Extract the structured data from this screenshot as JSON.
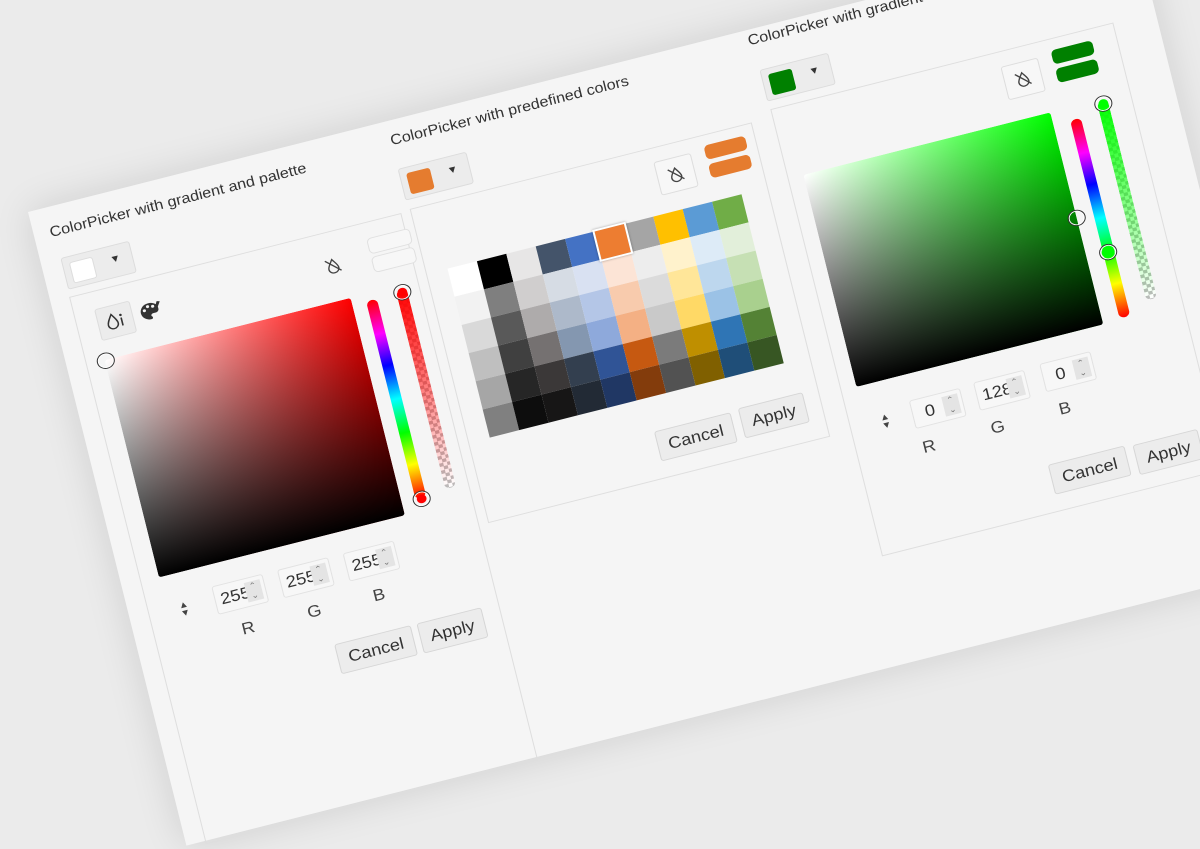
{
  "colors": {
    "orange": "#e57c2f",
    "green": "#008000",
    "white": "#ffffff"
  },
  "panels": {
    "gradient_palette": {
      "title": "ColorPicker with gradient and palette",
      "selected_color": "#ffffff",
      "inputs": [
        {
          "label": "R",
          "value": "255"
        },
        {
          "label": "G",
          "value": "255"
        },
        {
          "label": "B",
          "value": "255"
        }
      ],
      "cancel": "Cancel",
      "apply": "Apply"
    },
    "predefined": {
      "title": "ColorPicker with predefined colors",
      "selected_color": "#e57c2f",
      "cancel": "Cancel",
      "apply": "Apply",
      "palette": [
        [
          "#ffffff",
          "#000000",
          "#e7e6e6",
          "#44546a",
          "#4472c4",
          "#ed7d31",
          "#a5a5a5",
          "#ffc000",
          "#5b9bd5",
          "#70ad47"
        ],
        [
          "#f2f2f2",
          "#7f7f7f",
          "#d0cece",
          "#d6dce4",
          "#d9e1f2",
          "#fce4d6",
          "#ededed",
          "#fff2cc",
          "#ddebf7",
          "#e2efda"
        ],
        [
          "#d9d9d9",
          "#595959",
          "#aeabab",
          "#adb9ca",
          "#b4c6e7",
          "#f8cbad",
          "#dbdbdb",
          "#ffe699",
          "#bdd7ee",
          "#c6e0b4"
        ],
        [
          "#bfbfbf",
          "#404040",
          "#757171",
          "#8497b0",
          "#8ea9db",
          "#f4b084",
          "#c9c9c9",
          "#ffd966",
          "#9bc2e6",
          "#a9d08e"
        ],
        [
          "#a6a6a6",
          "#262626",
          "#3b3838",
          "#333f4f",
          "#305496",
          "#c65911",
          "#7b7b7b",
          "#bf8f00",
          "#2f75b5",
          "#548235"
        ],
        [
          "#808080",
          "#0d0d0d",
          "#171616",
          "#222a35",
          "#203764",
          "#833c0c",
          "#525252",
          "#806000",
          "#1f4e78",
          "#375623"
        ]
      ],
      "selected_cell": [
        0,
        5
      ]
    },
    "gradient": {
      "title": "ColorPicker with gradient",
      "selected_color": "#008000",
      "inputs": [
        {
          "label": "R",
          "value": "0"
        },
        {
          "label": "G",
          "value": "128"
        },
        {
          "label": "B",
          "value": "0"
        }
      ],
      "cancel": "Cancel",
      "apply": "Apply",
      "hue_fraction": 0.667
    }
  },
  "icons": {
    "dropdown": "caret-down-icon",
    "no_color": "droplet-slash-icon",
    "gradient_tab": "droplet-info-icon",
    "palette_tab": "palette-icon",
    "toggle": "up-down-arrows-icon"
  }
}
